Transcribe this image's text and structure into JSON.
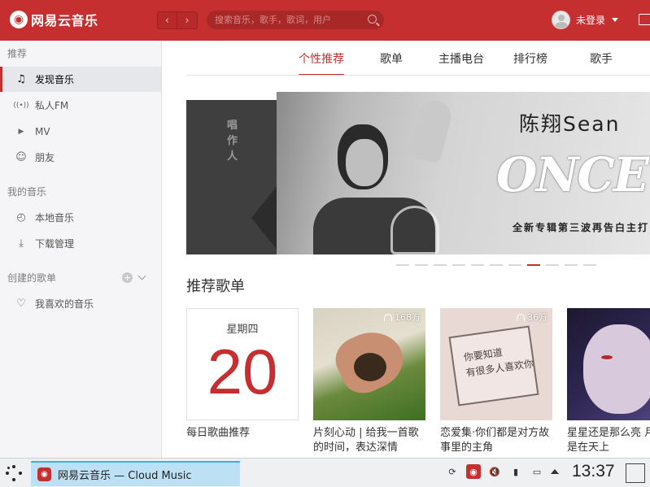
{
  "header": {
    "app_name": "网易云音乐",
    "back_glyph": "‹",
    "forward_glyph": "›",
    "search_placeholder": "搜索音乐，歌手，歌词，用户",
    "user_label": "未登录",
    "colors": {
      "brand": "#c62f2f"
    }
  },
  "sidebar": {
    "sections": [
      {
        "title": "推荐",
        "items": [
          {
            "label": "发现音乐",
            "icon": "music-note-icon",
            "glyph": "♫",
            "active": true
          },
          {
            "label": "私人FM",
            "icon": "radio-icon",
            "glyph": "((•))",
            "active": false
          },
          {
            "label": "MV",
            "icon": "video-icon",
            "glyph": "▶",
            "active": false
          },
          {
            "label": "朋友",
            "icon": "friends-icon",
            "glyph": "☺",
            "active": false
          }
        ]
      },
      {
        "title": "我的音乐",
        "items": [
          {
            "label": "本地音乐",
            "icon": "local-music-icon",
            "glyph": "◴",
            "active": false
          },
          {
            "label": "下载管理",
            "icon": "download-icon",
            "glyph": "⤓",
            "active": false
          }
        ]
      },
      {
        "title": "创建的歌单",
        "items": [
          {
            "label": "我喜欢的音乐",
            "icon": "heart-icon",
            "glyph": "♡",
            "active": false
          }
        ]
      }
    ]
  },
  "main": {
    "tabs": [
      {
        "label": "个性推荐",
        "active": true
      },
      {
        "label": "歌单",
        "active": false
      },
      {
        "label": "主播电台",
        "active": false
      },
      {
        "label": "排行榜",
        "active": false
      },
      {
        "label": "歌手",
        "active": false
      }
    ],
    "banner": {
      "left_text": "唱作人",
      "artist": "陈翔Sean",
      "script_title": "ONCE",
      "subtitle": "全新专辑第三波再告白主打",
      "dot_count": 11,
      "active_dot_index": 7
    },
    "recommend_title": "推荐歌单",
    "playlists": [
      {
        "title": "每日歌曲推荐",
        "weekday": "星期四",
        "day": "20",
        "kind": "daily"
      },
      {
        "title": "片刻心动 | 给我一首歌的时间，表达深情",
        "play_count": "168万",
        "kind": "cover1"
      },
      {
        "title": "恋爱集·你们都是对方故事里的主角",
        "play_count": "36万",
        "cover_text": "你要知道\n有很多人喜欢你",
        "kind": "cover2"
      },
      {
        "title": "星星还是那么亮 月亮还是在天上",
        "play_count": "",
        "kind": "cover3"
      }
    ]
  },
  "taskbar": {
    "window_title": "网易云音乐 — Cloud Music",
    "time": "13:37",
    "tray_icons": [
      "update-icon",
      "netease-tray-icon",
      "volume-muted-icon",
      "battery-icon",
      "network-icon"
    ]
  }
}
